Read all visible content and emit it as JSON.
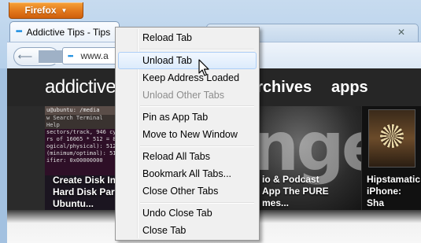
{
  "browser": {
    "app_button": "Firefox",
    "tabs": [
      {
        "title": "Addictive Tips - Tips",
        "active": true
      },
      {
        "title": "",
        "active": false
      }
    ],
    "url": "www.a",
    "back_icon": "back-arrow-icon",
    "forward_icon": "forward-arrow-icon"
  },
  "page": {
    "logo": "addictive",
    "nav": [
      "archives",
      "apps"
    ],
    "cards": [
      {
        "terminal_title": "u@ubuntu: /media",
        "terminal_menu": "w  Search  Terminal  Help",
        "terminal_lines": [
          "sectors/track, 946 cyli",
          "rs of 16065 * 512 = 8",
          "ogical/physical): 512",
          "(minimum/optimal): 512 byte",
          "ifier: 0x00000000"
        ],
        "title": "Create Disk In\nHard Disk Par\nUbuntu..."
      },
      {
        "bg_text": "nge",
        "title": "io & Podcast\nApp The PURE\nmes..."
      },
      {
        "title": "Hipstamatic\niPhone: Sha\nWith Faceboo"
      }
    ]
  },
  "context_menu": {
    "items": [
      {
        "label": "Reload Tab",
        "state": "normal"
      },
      {
        "label": "Unload Tab",
        "state": "hover"
      },
      {
        "label": "Keep Address Loaded",
        "state": "normal"
      },
      {
        "label": "Unload Other Tabs",
        "state": "disabled"
      },
      {
        "label": "Pin as App Tab",
        "state": "normal"
      },
      {
        "label": "Move to New Window",
        "state": "normal"
      },
      {
        "label": "Reload All Tabs",
        "state": "normal"
      },
      {
        "label": "Bookmark All Tabs...",
        "state": "normal"
      },
      {
        "label": "Close Other Tabs",
        "state": "normal"
      },
      {
        "label": "Undo Close Tab",
        "state": "normal"
      },
      {
        "label": "Close Tab",
        "state": "normal"
      }
    ]
  },
  "colors": {
    "firefox_orange": "#e2781c",
    "menu_hover": "#dcebfc",
    "favicon_blue": "#1a8de0"
  }
}
